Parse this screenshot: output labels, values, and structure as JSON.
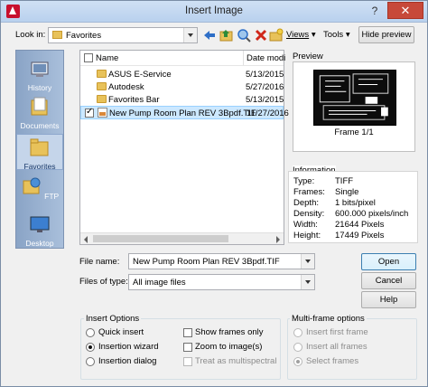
{
  "window": {
    "title": "Insert Image",
    "help_glyph": "?",
    "close_glyph": "✕"
  },
  "toolbar": {
    "look_in_label": "Look in:",
    "look_in_value": "Favorites",
    "views_label": "Views",
    "tools_label": "Tools",
    "hide_preview_label": "Hide preview"
  },
  "places": [
    {
      "label": "History",
      "icon": "history-icon"
    },
    {
      "label": "Documents",
      "icon": "documents-icon"
    },
    {
      "label": "Favorites",
      "icon": "favorites-icon"
    },
    {
      "label": "FTP",
      "icon": "ftp-icon"
    },
    {
      "label": "Desktop",
      "icon": "desktop-icon"
    }
  ],
  "file_list": {
    "columns": [
      "Name",
      "Date modi"
    ],
    "rows": [
      {
        "name": "ASUS E-Service",
        "date": "5/13/2015",
        "type": "folder"
      },
      {
        "name": "Autodesk",
        "date": "5/27/2016",
        "type": "folder"
      },
      {
        "name": "Favorites Bar",
        "date": "5/13/2015",
        "type": "folder"
      },
      {
        "name": "New Pump Room Plan REV 3Bpdf.TIF",
        "date": "11/27/2016",
        "type": "tif"
      }
    ]
  },
  "preview": {
    "label": "Preview",
    "caption": "Frame 1/1"
  },
  "information": {
    "label": "Information",
    "rows": [
      {
        "key": "Type:",
        "value": "TIFF"
      },
      {
        "key": "Frames:",
        "value": "Single"
      },
      {
        "key": "Depth:",
        "value": "1 bits/pixel"
      },
      {
        "key": "Density:",
        "value": "600.000 pixels/inch"
      },
      {
        "key": "Width:",
        "value": "21644 Pixels"
      },
      {
        "key": "Height:",
        "value": "17449 Pixels"
      }
    ]
  },
  "file_name": {
    "label": "File name:",
    "value": "New Pump Room Plan REV 3Bpdf.TIF"
  },
  "files_of_type": {
    "label": "Files of type:",
    "value": "All image files"
  },
  "buttons": {
    "open": "Open",
    "cancel": "Cancel",
    "help": "Help"
  },
  "insert_options": {
    "label": "Insert Options",
    "quick_insert": "Quick insert",
    "insertion_wizard": "Insertion wizard",
    "insertion_dialog": "Insertion dialog",
    "show_frames_only": "Show frames only",
    "zoom_to_images": "Zoom to image(s)",
    "treat_as_multispectral": "Treat as multispectral"
  },
  "multi_frame_options": {
    "label": "Multi-frame options",
    "insert_first_frame": "Insert first frame",
    "insert_all_frames": "Insert all frames",
    "select_frames": "Select frames"
  }
}
